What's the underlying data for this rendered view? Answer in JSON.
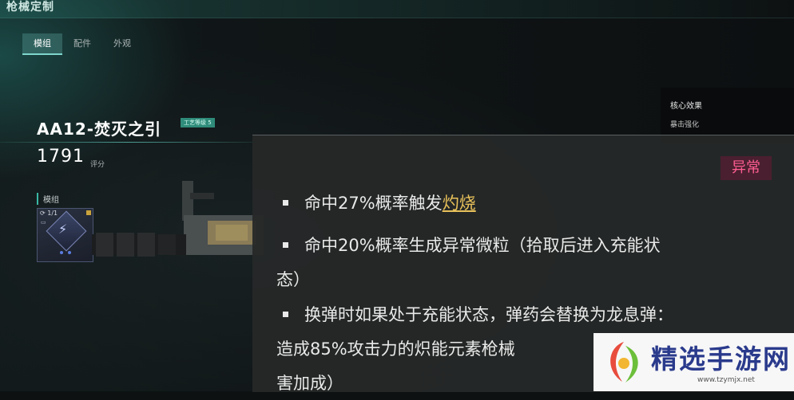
{
  "header": {
    "title": "枪械定制"
  },
  "tabs": [
    {
      "label": "模组",
      "active": true
    },
    {
      "label": "配件",
      "active": false
    },
    {
      "label": "外观",
      "active": false
    }
  ],
  "weapon": {
    "name": "AA12-焚灭之引",
    "craft_badge": "工艺等级 5",
    "score": "1791",
    "score_label": "评分"
  },
  "mod_section": {
    "label": "模组",
    "slot_count": "1/1",
    "slot_icon": "lightning-figure-icon",
    "rarity_color": "#c9a23c"
  },
  "core_panel": {
    "title": "核心效果",
    "item": "暴击强化"
  },
  "effect_popup": {
    "tag": "异常",
    "tag_color": "#ff5e92",
    "lines": [
      {
        "pre": "命中27%概率触发",
        "highlight": "灼烧",
        "post": ""
      },
      {
        "pre": "命中20%概率生成异常微粒（拾取后进入充能状",
        "highlight": "",
        "post": ""
      },
      {
        "pre": "态）",
        "highlight": "",
        "post": ""
      },
      {
        "pre": "换弹时如果处于充能状态，弹药会替换为龙息弹：",
        "highlight": "",
        "post": ""
      },
      {
        "pre": "造成85%攻击力的炽能元素枪械",
        "highlight": "",
        "post": ""
      },
      {
        "pre": "害加成）",
        "highlight": "",
        "post": ""
      }
    ]
  },
  "watermark": {
    "text": "精选手游网",
    "url": "www.tzymjx.net"
  },
  "colors": {
    "accent": "#39b8a5",
    "highlight": "#e8c15a"
  }
}
